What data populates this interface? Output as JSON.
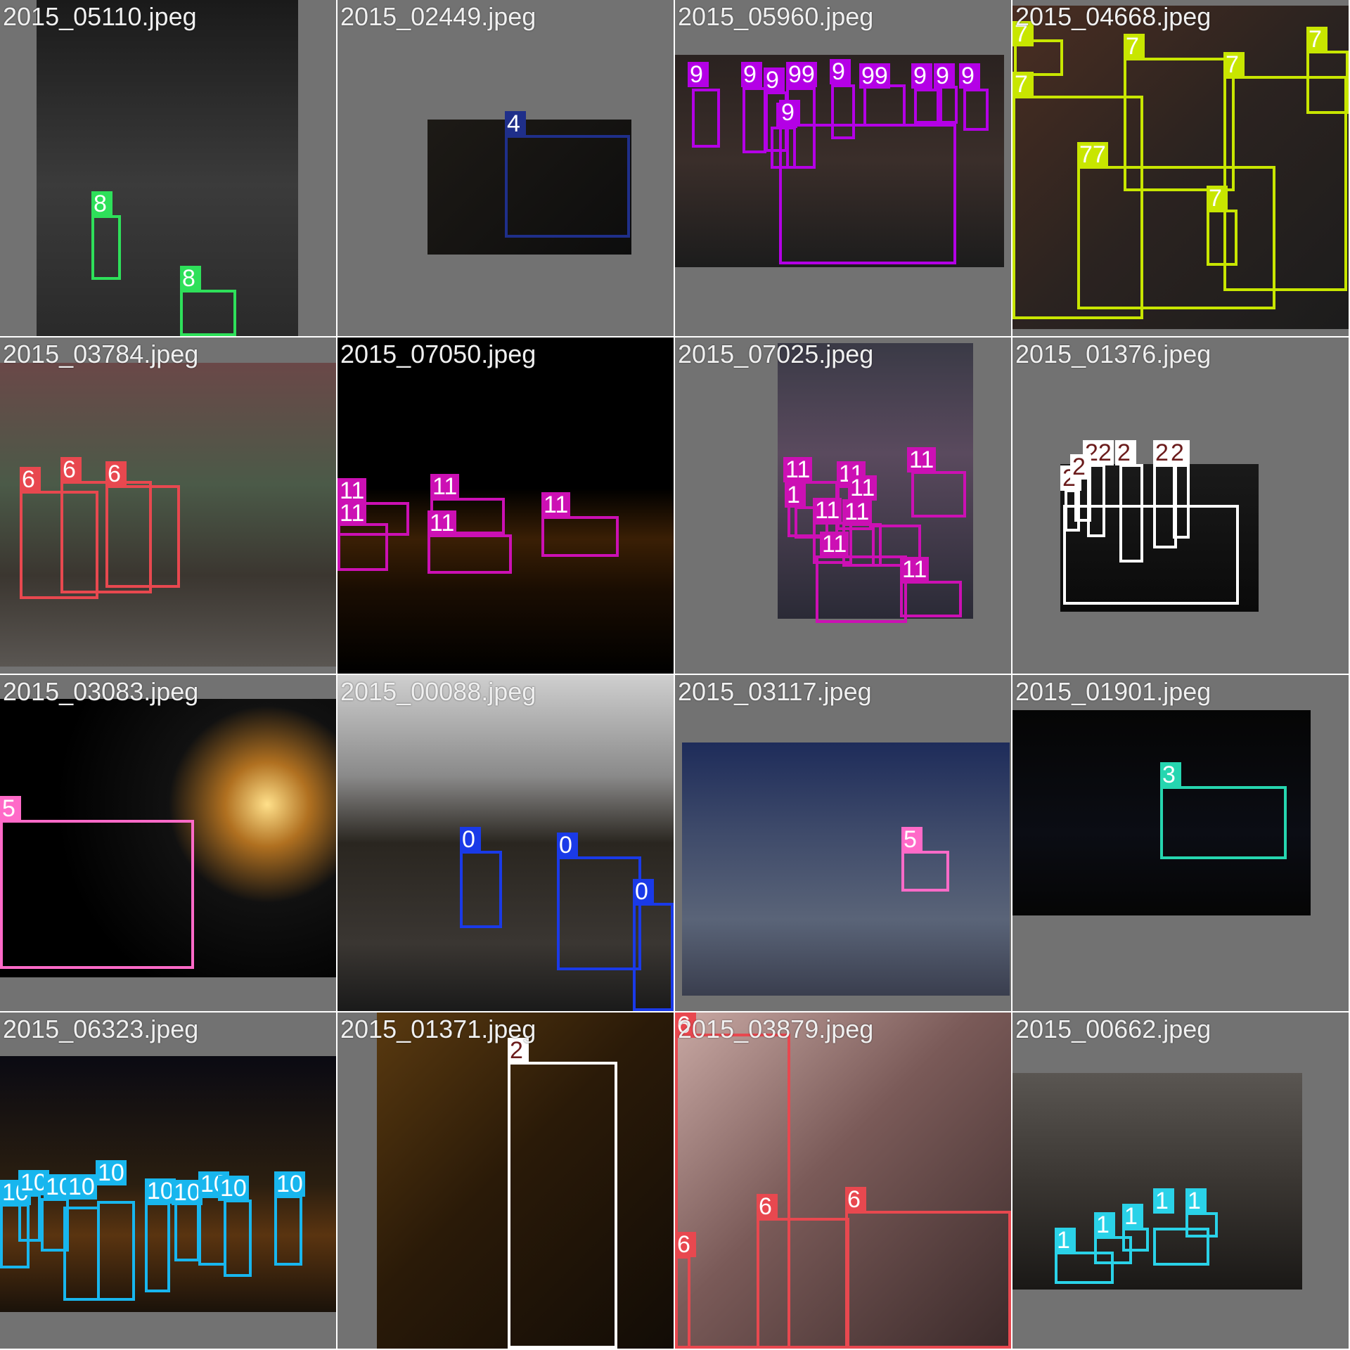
{
  "mosaic": {
    "tiles": [
      {
        "file": "2015_05110.jpeg",
        "label_color": "#2ee05a",
        "labels": [
          "8",
          "8"
        ]
      },
      {
        "file": "2015_02449.jpeg",
        "label_color": "#1f2f8a",
        "labels": [
          "4"
        ]
      },
      {
        "file": "2015_05960.jpeg",
        "label_color": "#b400e6",
        "labels": [
          "9",
          "9",
          "9",
          "99",
          "9",
          "9",
          "99",
          "9",
          "9",
          "9",
          "9"
        ]
      },
      {
        "file": "2015_04668.jpeg",
        "label_color": "#c8e600",
        "labels": [
          "7",
          "7",
          "7",
          "7",
          "7",
          "77",
          "7"
        ]
      },
      {
        "file": "2015_03784.jpeg",
        "label_color": "#e8484f",
        "labels": [
          "6",
          "6",
          "6"
        ]
      },
      {
        "file": "2015_07050.jpeg",
        "label_color": "#cc10b4",
        "labels": [
          "11",
          "11",
          "11",
          "11",
          "11"
        ]
      },
      {
        "file": "2015_07025.jpeg",
        "label_color": "#cc10b4",
        "labels": [
          "11",
          "11",
          "1",
          "11",
          "11",
          "11",
          "11",
          "11",
          "11"
        ]
      },
      {
        "file": "2015_01376.jpeg",
        "label_color": "#ffffff",
        "labels": [
          "22",
          "2",
          "2",
          "2",
          "2",
          "2"
        ]
      },
      {
        "file": "2015_03083.jpeg",
        "label_color": "#ff6ac8",
        "labels": [
          "5"
        ]
      },
      {
        "file": "2015_00088.jpeg",
        "label_color": "#1a3ae8",
        "labels": [
          "0",
          "0",
          "0"
        ]
      },
      {
        "file": "2015_03117.jpeg",
        "label_color": "#ff6ac8",
        "labels": [
          "5"
        ]
      },
      {
        "file": "2015_01901.jpeg",
        "label_color": "#26d6b0",
        "labels": [
          "3"
        ]
      },
      {
        "file": "2015_06323.jpeg",
        "label_color": "#18b6ee",
        "labels": [
          "10",
          "10",
          "10",
          "10",
          "10",
          "10",
          "10",
          "10",
          "10",
          "10"
        ]
      },
      {
        "file": "2015_01371.jpeg",
        "label_color": "#ffffff",
        "labels": [
          "2"
        ]
      },
      {
        "file": "2015_03879.jpeg",
        "label_color": "#e8484f",
        "labels": [
          "6",
          "6",
          "6",
          "6"
        ]
      },
      {
        "file": "2015_00662.jpeg",
        "label_color": "#2ad2e8",
        "labels": [
          "1",
          "1",
          "1",
          "1",
          "1"
        ]
      }
    ]
  }
}
